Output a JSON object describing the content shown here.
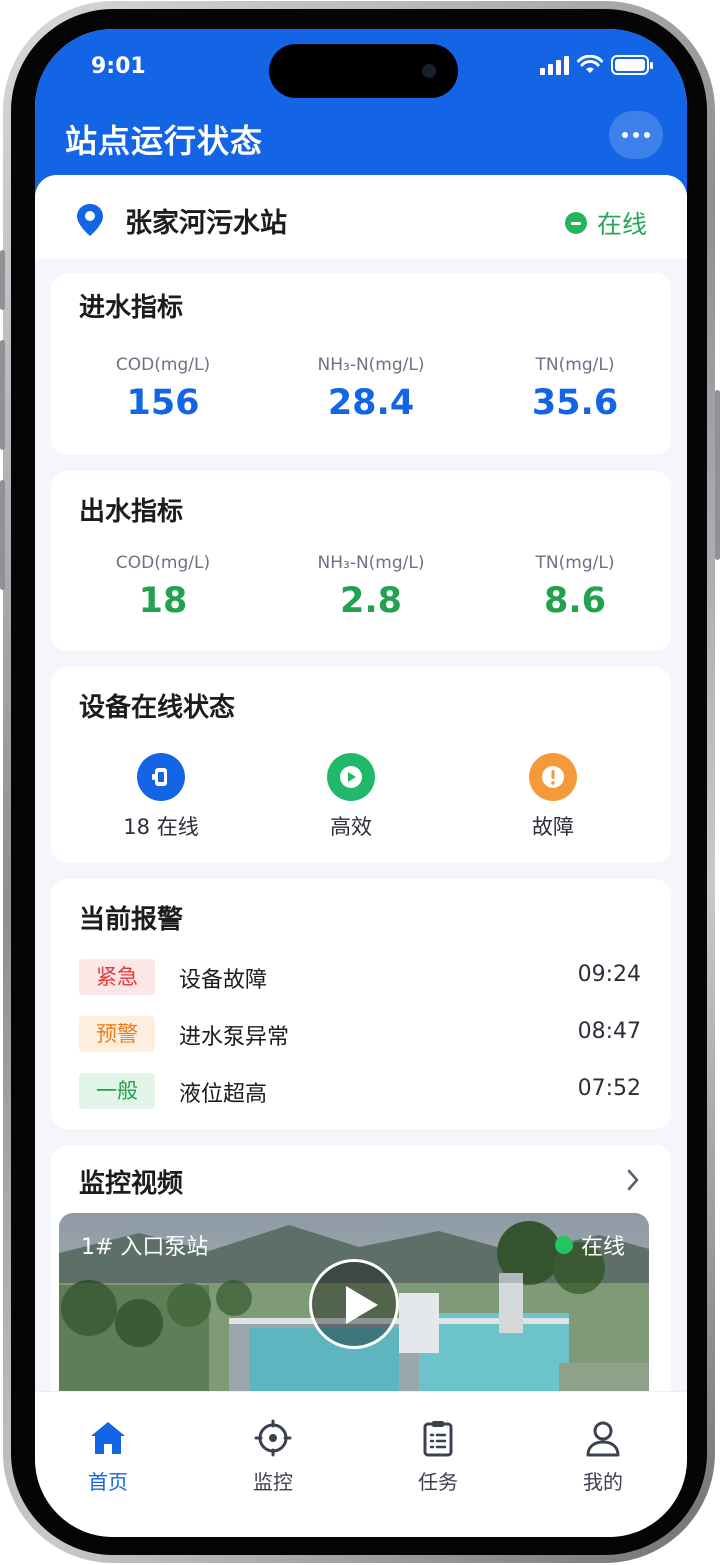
{
  "status_bar": {
    "time": "9:01"
  },
  "header": {
    "title": "站点运行状态",
    "more_icon": "more-dots-icon"
  },
  "station": {
    "name": "张家河污水站",
    "status": "在线",
    "pin_icon": "location-pin-icon"
  },
  "inflow": {
    "title": "进水指标",
    "metrics": [
      {
        "label": "COD(mg/L)",
        "value": "156"
      },
      {
        "label": "NH₃-N(mg/L)",
        "value": "28.4"
      },
      {
        "label": "TN(mg/L)",
        "value": "35.6"
      }
    ]
  },
  "outflow": {
    "title": "出水指标",
    "metrics": [
      {
        "label": "COD(mg/L)",
        "value": "18"
      },
      {
        "label": "NH₃-N(mg/L)",
        "value": "2.8"
      },
      {
        "label": "TN(mg/L)",
        "value": "8.6"
      }
    ]
  },
  "devices": {
    "title": "设备在线状态",
    "items": [
      {
        "label": "18 在线",
        "icon": "device-icon",
        "color": "#1464e6"
      },
      {
        "label": "高效",
        "icon": "play-circle-icon",
        "color": "#22b86a"
      },
      {
        "label": "故障",
        "icon": "alert-icon",
        "color": "#f59a3a"
      }
    ]
  },
  "alarms": {
    "title": "当前报警",
    "items": [
      {
        "level": "紧急",
        "text": "设备故障",
        "time": "09:24"
      },
      {
        "level": "预警",
        "text": "进水泵异常",
        "time": "08:47"
      },
      {
        "level": "一般",
        "text": "液位超高",
        "time": "07:52"
      }
    ]
  },
  "video": {
    "title": "监控视频",
    "feed_label": "1# 入口泵站",
    "feed_status": "在线"
  },
  "tabbar": {
    "items": [
      {
        "label": "首页",
        "icon": "home-icon",
        "active": true
      },
      {
        "label": "监控",
        "icon": "monitor-icon",
        "active": false
      },
      {
        "label": "任务",
        "icon": "clipboard-icon",
        "active": false
      },
      {
        "label": "我的",
        "icon": "user-icon",
        "active": false
      }
    ]
  },
  "colors": {
    "primary": "#1464e6",
    "success": "#22a14f",
    "danger": "#e23a3a",
    "warning": "#ef7d1a"
  }
}
